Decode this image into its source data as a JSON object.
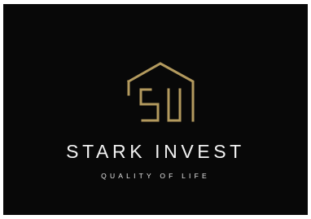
{
  "brand": {
    "name": "STARK INVEST",
    "tagline": "QUALITY OF LIFE",
    "logo_icon": "house-si-monogram-icon"
  },
  "colors": {
    "background": "#080808",
    "text": "#f2f2f2",
    "logo_gold": "#b39a5e"
  }
}
